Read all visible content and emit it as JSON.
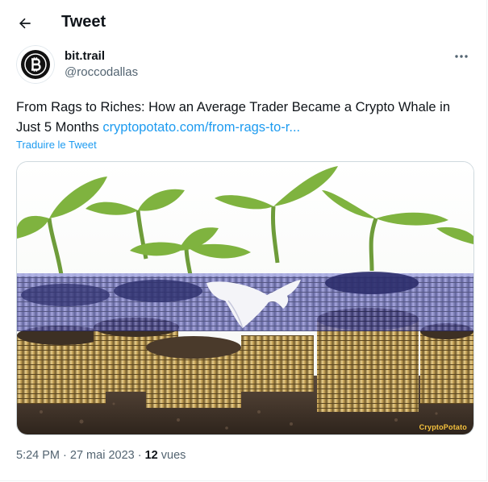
{
  "header": {
    "title": "Tweet",
    "back_icon": "arrow-left-icon"
  },
  "author": {
    "display_name": "bit.trail",
    "handle": "@roccodallas",
    "avatar_icon": "bitcoin-logo-icon",
    "more_icon": "more-options-icon"
  },
  "tweet": {
    "text": "From Rags to Riches: How an Average Trader Became a Crypto Whale in Just 5 Months",
    "link": "cryptopotato.com/from-rags-to-r...",
    "translate_label": "Traduire le Tweet"
  },
  "media": {
    "watermark": "CryptoPotato"
  },
  "meta": {
    "time": "5:24 PM",
    "separator": " · ",
    "date": "27 mai 2023",
    "views_count": "12",
    "views_label": "vues"
  },
  "colors": {
    "accent": "#1d9bf0",
    "secondary_text": "#536471",
    "border": "#cfd9de"
  }
}
